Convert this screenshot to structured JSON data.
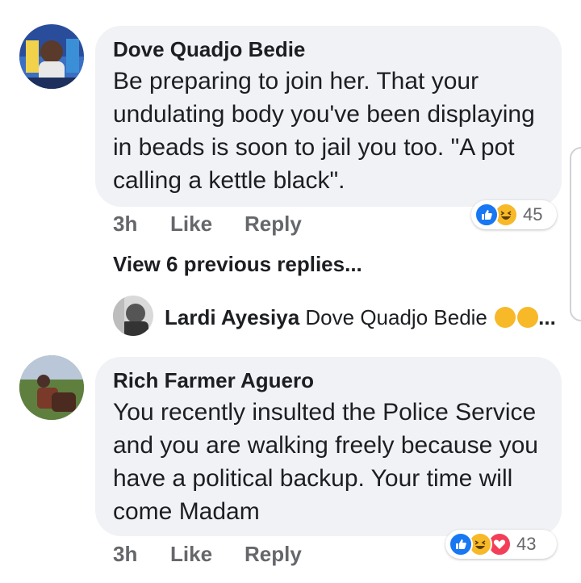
{
  "comments": [
    {
      "author": "Dove Quadjo Bedie",
      "text": "Be preparing to join her. That your undulating body you've been displaying in beads is soon to jail you too. \"A pot calling a kettle black\".",
      "time": "3h",
      "like_label": "Like",
      "reply_label": "Reply",
      "reactions": [
        "like",
        "haha"
      ],
      "reaction_count": "45"
    },
    {
      "author": "Rich Farmer Aguero",
      "text": "You recently insulted the Police Service and you are walking freely because you have a political backup. Your time will come Madam",
      "time": "3h",
      "like_label": "Like",
      "reply_label": "Reply",
      "reactions": [
        "like",
        "haha",
        "love"
      ],
      "reaction_count": "43"
    }
  ],
  "view_replies_label": "View 6 previous replies...",
  "reply_preview": {
    "author": "Lardi Ayesiya",
    "text": "Dove Quadjo Bedie",
    "ellipsis": "..."
  },
  "colors": {
    "bubble": "#f0f2f5",
    "like_blue": "#1877f2",
    "haha_yellow": "#f7b928",
    "love_red": "#f33e58",
    "meta_gray": "#65676b"
  }
}
